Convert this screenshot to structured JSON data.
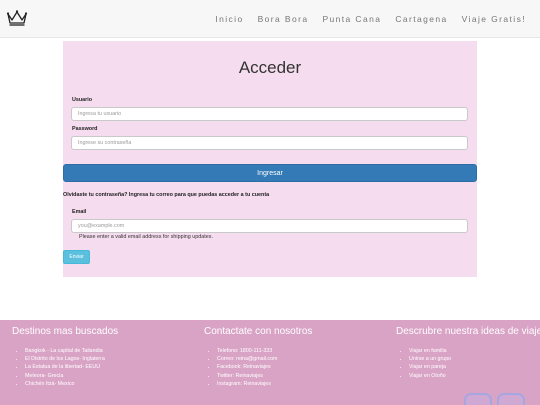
{
  "nav": {
    "links": [
      "Inicio",
      "Bora Bora",
      "Punta Cana",
      "Cartagena",
      "Viaje Gratis!"
    ]
  },
  "login": {
    "title": "Acceder",
    "username_label": "Usuario",
    "username_placeholder": "Ingresa tu usuario",
    "password_label": "Password",
    "password_placeholder": "Ingrese su contraseña",
    "submit_label": "Ingresar"
  },
  "recover": {
    "prompt": "Olvidaste tu contraseña? Ingresa tu correo para que puedas acceder a tu cuenta",
    "email_label": "Email",
    "email_placeholder": "you@example.com",
    "hint": "Please enter a valid email address for shipping updates.",
    "submit_label": "Enviar"
  },
  "footer": {
    "destinations": {
      "title": "Destinos mas buscados",
      "items": [
        "Bangkok - La capital de Tailandia",
        "El Distrito de los Lagos- Inglaterra",
        "La Estatua de la libertad- EEUU",
        "Meteora- Grecia",
        "Chichén Itzá- Mexico"
      ]
    },
    "contact": {
      "title": "Contactate con nosotros",
      "items": [
        "Telefono: 1800-111-333",
        "Correo: reina@gmail.com",
        "Facebook: Reinaviajes",
        "Twitter: Reinaviajes",
        "Instagram: Reinaviajes"
      ]
    },
    "ideas": {
      "title": "Descrubre nuestra ideas de viaje",
      "items": [
        "Viajar en familia",
        "Unirse a un grupo",
        "Viajar en pareja",
        "Viajar en Otoño"
      ]
    }
  },
  "colors": {
    "panel_bg": "#f6dcef",
    "primary_button": "#337ab7",
    "info_button": "#5bc0de",
    "footer_bg": "#d9a3c6"
  },
  "icons": {
    "logo": "crown-icon",
    "social": [
      "social-icon-1",
      "social-icon-2"
    ]
  }
}
